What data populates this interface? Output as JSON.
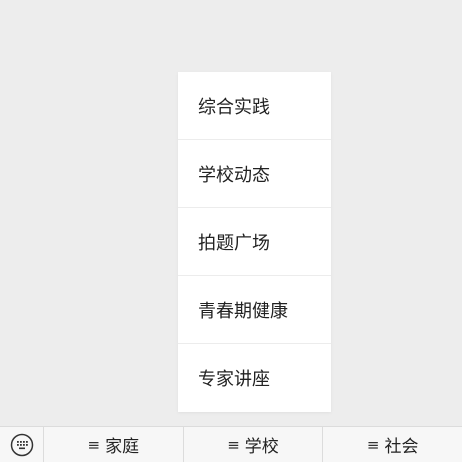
{
  "popup_menu": {
    "items": [
      {
        "label": "综合实践"
      },
      {
        "label": "学校动态"
      },
      {
        "label": "拍题广场"
      },
      {
        "label": "青春期健康"
      },
      {
        "label": "专家讲座"
      }
    ]
  },
  "bottom_menu": {
    "keyboard_icon": "keyboard-icon",
    "menu_glyph": "≡",
    "tabs": [
      {
        "label": "家庭"
      },
      {
        "label": "学校"
      },
      {
        "label": "社会"
      }
    ]
  }
}
